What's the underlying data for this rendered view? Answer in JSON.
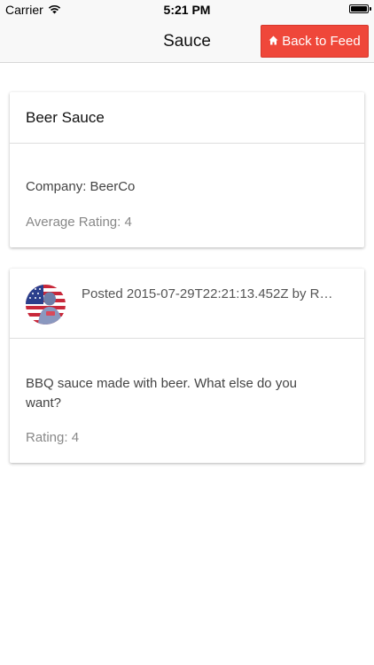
{
  "status_bar": {
    "carrier": "Carrier",
    "time": "5:21 PM",
    "battery_level": 1.0
  },
  "nav": {
    "title": "Sauce",
    "back_label": "Back to Feed",
    "back_icon": "home-icon",
    "accent_color": "#ef473a"
  },
  "sauce": {
    "name": "Beer Sauce",
    "company": "Company: BeerCo",
    "average_rating": "Average Rating: 4"
  },
  "review": {
    "posted": "Posted 2015-07-29T22:21:13.452Z by R…",
    "avatar_icon": "user-avatar-flag",
    "body": "BBQ sauce made with beer. What else do you want?",
    "rating": "Rating: 4"
  }
}
